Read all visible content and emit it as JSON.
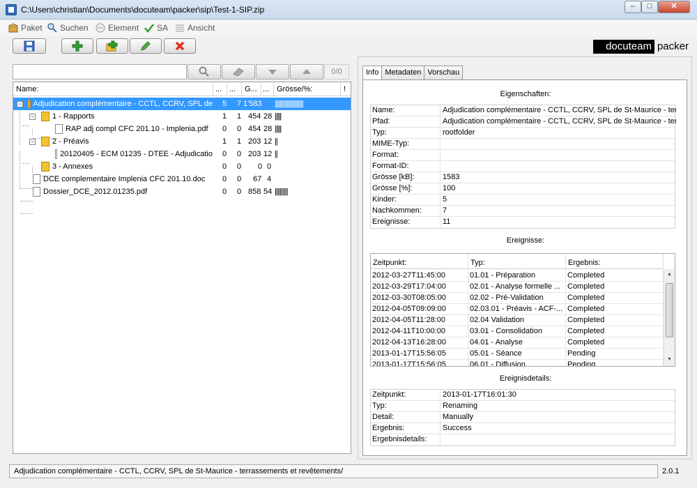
{
  "window": {
    "title": "C:\\Users\\christian\\Documents\\docuteam\\packer\\sip\\Test-1-SIP.zip"
  },
  "menu": [
    "Paket",
    "Suchen",
    "Element",
    "SA",
    "Ansicht"
  ],
  "logo": {
    "dark": "docuteam",
    "light": "packer"
  },
  "search": {
    "value": "",
    "counter": "0/0"
  },
  "tree": {
    "headers": [
      "Name:",
      "...",
      "...",
      "G...",
      "...",
      "Grösse/%:",
      "!"
    ],
    "rows": [
      {
        "name": "Adjudication complémentaire - CCTL, CCRV, SPL de",
        "c1": "5",
        "c2": "7",
        "size": "1'583",
        "pct": "",
        "bars": "||||||||||||||||||||||"
      },
      {
        "name": "1 - Rapports",
        "c1": "1",
        "c2": "1",
        "size": "454",
        "pct": "28",
        "bars": "|||||"
      },
      {
        "name": "RAP adj compl CFC 201.10 - Implenia.pdf",
        "c1": "0",
        "c2": "0",
        "size": "454",
        "pct": "28",
        "bars": "|||||"
      },
      {
        "name": "2 - Préavis",
        "c1": "1",
        "c2": "1",
        "size": "203",
        "pct": "12",
        "bars": "||"
      },
      {
        "name": "20120405 - ECM 01235 - DTEE - Adjudicatio",
        "c1": "0",
        "c2": "0",
        "size": "203",
        "pct": "12",
        "bars": "||"
      },
      {
        "name": "3 - Annexes",
        "c1": "0",
        "c2": "0",
        "size": "0",
        "pct": "0",
        "bars": ""
      },
      {
        "name": "DCE complementaire Implenia CFC 201.10.doc",
        "c1": "0",
        "c2": "0",
        "size": "67",
        "pct": "4",
        "bars": ""
      },
      {
        "name": "Dossier_DCE_2012.01235.pdf",
        "c1": "0",
        "c2": "0",
        "size": "858",
        "pct": "54",
        "bars": "||||||||||"
      }
    ]
  },
  "tabs": [
    "Info",
    "Metadaten",
    "Vorschau"
  ],
  "properties": {
    "title": "Eigenschaften:",
    "rows": [
      {
        "key": "Name:",
        "value": "Adjudication complémentaire - CCTL, CCRV, SPL de St-Maurice - ter..."
      },
      {
        "key": "Pfad:",
        "value": "Adjudication complémentaire - CCTL, CCRV, SPL de St-Maurice - ter..."
      },
      {
        "key": "Typ:",
        "value": "rootfolder"
      },
      {
        "key": "MIME-Typ:",
        "value": ""
      },
      {
        "key": "Format:",
        "value": ""
      },
      {
        "key": "Format-ID:",
        "value": ""
      },
      {
        "key": "Grösse [kB]:",
        "value": "1583"
      },
      {
        "key": "Grösse [%]:",
        "value": "100"
      },
      {
        "key": "Kinder:",
        "value": "5"
      },
      {
        "key": "Nachkommen:",
        "value": "7"
      },
      {
        "key": "Ereignisse:",
        "value": "11"
      }
    ]
  },
  "events": {
    "title": "Ereignisse:",
    "headers": [
      "Zeitpunkt:",
      "Typ:",
      "Ergebnis:"
    ],
    "rows": [
      {
        "time": "2012-03-27T11:45:00",
        "type": "01.01 - Préparation",
        "result": "Completed"
      },
      {
        "time": "2012-03-29T17:04:00",
        "type": "02.01 - Analyse formelle ...",
        "result": "Completed"
      },
      {
        "time": "2012-03-30T08:05:00",
        "type": "02.02 - Pré-Validation",
        "result": "Completed"
      },
      {
        "time": "2012-04-05T09:09:00",
        "type": "02.03.01 - Préavis - ACF-...",
        "result": "Completed"
      },
      {
        "time": "2012-04-05T11:28:00",
        "type": "02.04 Validation",
        "result": "Completed"
      },
      {
        "time": "2012-04-11T10:00:00",
        "type": "03.01 - Consolidation",
        "result": "Completed"
      },
      {
        "time": "2012-04-13T16:28:00",
        "type": "04.01 - Analyse",
        "result": "Completed"
      },
      {
        "time": "2013-01-17T15:56:05",
        "type": "05.01 - Séance",
        "result": "Pending"
      },
      {
        "time": "2013-01-17T15:56:05",
        "type": "06.01 - Diffusion",
        "result": "Pending"
      }
    ]
  },
  "eventdetails": {
    "title": "Ereignisdetails:",
    "rows": [
      {
        "key": "Zeitpunkt:",
        "value": "2013-01-17T16:01:30"
      },
      {
        "key": "Typ:",
        "value": "Renaming"
      },
      {
        "key": "Detail:",
        "value": "Manually"
      },
      {
        "key": "Ergebnis:",
        "value": "Success"
      },
      {
        "key": "Ergebnisdetails:",
        "value": ""
      }
    ]
  },
  "status": {
    "text": "Adjudication complémentaire - CCTL, CCRV, SPL de St-Maurice - terrassements et revêtements/",
    "version": "2.0.1"
  },
  "colors": {
    "selection": "#3399ff",
    "add": "#2ea02e",
    "delete": "#e0301e"
  }
}
